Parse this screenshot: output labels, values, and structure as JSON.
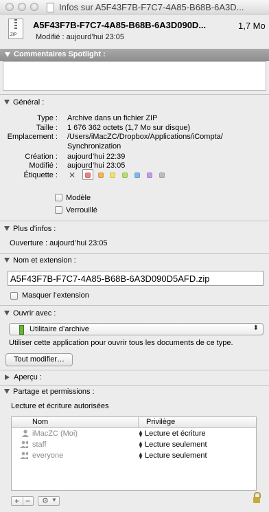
{
  "window": {
    "title": "Infos sur A5F43F7B-F7C7-4A85-B68B-6A3D..."
  },
  "header": {
    "icon": "zip-file-icon",
    "icon_label": "ZIP",
    "file_name": "A5F43F7B-F7C7-4A85-B68B-6A3D090D...",
    "file_size": "1,7 Mo",
    "modified": "Modifié : aujourd’hui 23:05"
  },
  "spotlight": {
    "label": "Commentaires Spotlight :",
    "value": ""
  },
  "general": {
    "label": "Général :",
    "type_label": "Type :",
    "type_value": "Archive dans un fichier ZIP",
    "size_label": "Taille :",
    "size_value": "1 676 362 octets (1,7 Mo sur disque)",
    "location_label": "Emplacement :",
    "location_value_1": "/Users/iMacZC/Dropbox/Applications/iCompta/",
    "location_value_2": "Synchronization",
    "created_label": "Création :",
    "created_value": "aujourd’hui 22:39",
    "modified_label": "Modifié :",
    "modified_value": "aujourd’hui 23:05",
    "tag_label": "Étiquette :",
    "tag_none": "✕",
    "tag_colors": [
      "#f08080",
      "#f5b25a",
      "#f2e36a",
      "#b9dd6a",
      "#7fb6f0",
      "#c49be8",
      "#bdbdbd"
    ],
    "stationery_label": "Modèle",
    "stationery_checked": false,
    "locked_label": "Verrouillé",
    "locked_checked": false
  },
  "more_info": {
    "label": "Plus d’infos :",
    "opened": "Ouverture : aujourd’hui 23:05"
  },
  "name_ext": {
    "label": "Nom et extension :",
    "value": "A5F43F7B-F7C7-4A85-B68B-6A3D090D5AFD.zip",
    "hide_ext_label": "Masquer l’extension",
    "hide_ext_checked": false
  },
  "open_with": {
    "label": "Ouvrir avec :",
    "app": "Utilitaire d’archive",
    "desc": "Utiliser cette application pour ouvrir tous les documents de ce type.",
    "change_all": "Tout modifier…"
  },
  "preview": {
    "label": "Aperçu :"
  },
  "sharing": {
    "label": "Partage et permissions :",
    "status": "Lecture et écriture autorisées",
    "col_name": "Nom",
    "col_priv": "Privilège",
    "rows": [
      {
        "name": "iMacZC (Moi)",
        "privilege": "Lecture et écriture",
        "icon": "user-icon"
      },
      {
        "name": "staff",
        "privilege": "Lecture seulement",
        "icon": "group-icon"
      },
      {
        "name": "everyone",
        "privilege": "Lecture seulement",
        "icon": "group-icon"
      }
    ],
    "add": "+",
    "remove": "−",
    "action_icon": "gear-icon",
    "lock_icon": "lock-icon"
  }
}
